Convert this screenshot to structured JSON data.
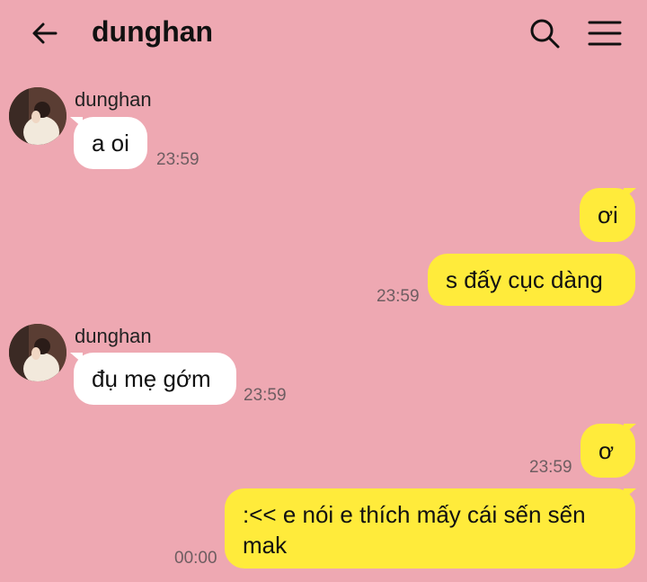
{
  "header": {
    "title": "dunghan",
    "back_icon": "arrow-left-icon",
    "search_icon": "search-icon",
    "menu_icon": "hamburger-menu-icon"
  },
  "colors": {
    "background": "#EEA8B2",
    "incoming_bubble": "#FFFFFF",
    "outgoing_bubble": "#FFEB3B"
  },
  "messages": [
    {
      "direction": "incoming",
      "sender": "dunghan",
      "text": "a oi",
      "time": "23:59"
    },
    {
      "direction": "outgoing",
      "text": "ơi",
      "time": ""
    },
    {
      "direction": "outgoing",
      "text": "s đấy cục dàng",
      "time": "23:59"
    },
    {
      "direction": "incoming",
      "sender": "dunghan",
      "text": "đụ mẹ gớm",
      "time": "23:59"
    },
    {
      "direction": "outgoing",
      "text": "ơ",
      "time": "23:59"
    },
    {
      "direction": "outgoing",
      "text": ":<< e nói e thích mấy cái sến sến mak",
      "time": "00:00"
    }
  ]
}
